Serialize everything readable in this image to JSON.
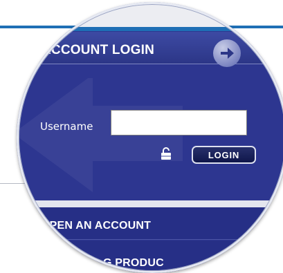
{
  "login_panel": {
    "title": "ACCOUNT LOGIN",
    "go_icon": "arrow-right-circle-icon",
    "username_label": "Username",
    "username_value": "",
    "lock_icon": "lock-icon",
    "login_button": "LOGIN"
  },
  "menu": {
    "items": [
      {
        "label": "OPEN AN ACCOUNT"
      },
      {
        "label": "G PRODUC"
      }
    ]
  },
  "colors": {
    "panel_blue": "#2d3690",
    "menu_blue": "#262f86",
    "header_rule": "#1f6fb5",
    "button_dark": "#0f164a"
  }
}
